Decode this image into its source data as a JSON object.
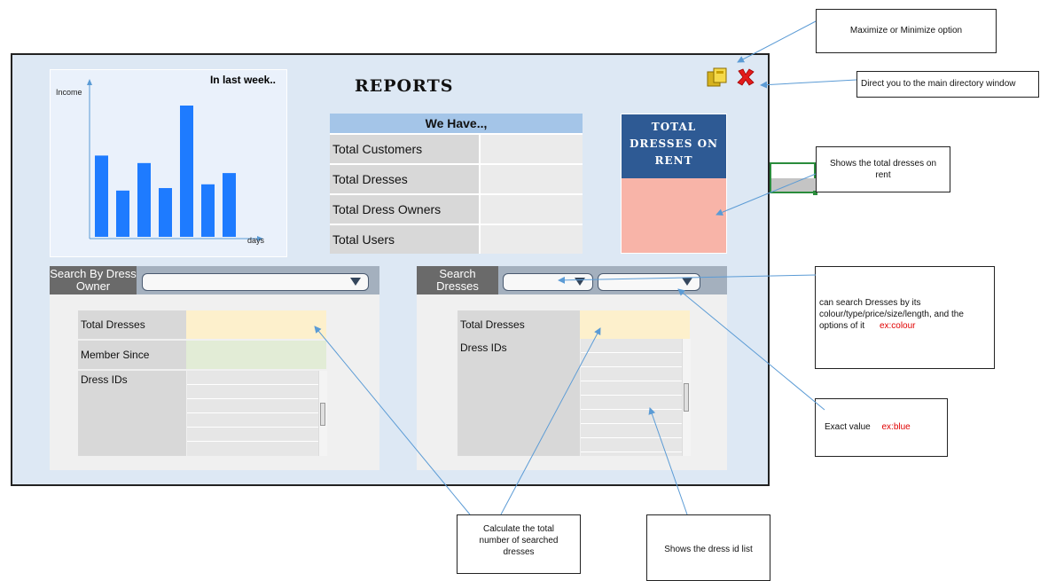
{
  "reports": {
    "title": "REPORTS",
    "chart": {
      "title": "In last week..",
      "ylabel": "Income",
      "xlabel": "days"
    },
    "we_have": {
      "header": "We Have..,",
      "rows": [
        "Total Customers",
        "Total Dresses",
        "Total Dress Owners",
        "Total Users"
      ]
    },
    "rent_box": {
      "title": "TOTAL DRESSES ON RENT"
    },
    "owner_search": {
      "tag": "Search By Dress Owner",
      "total_label": "Total Dresses",
      "member_label": "Member Since",
      "ids_label": "Dress IDs"
    },
    "dress_search": {
      "tag": "Search Dresses",
      "total_label": "Total Dresses",
      "ids_label": "Dress IDs"
    }
  },
  "colors": {
    "form_bg": "#dde8f4",
    "bar_color": "#1e7bff",
    "rent_header": "#2e5a94",
    "rent_body": "#f8b4a8",
    "total_field": "#fdf0cc",
    "member_field": "#e2ecd6",
    "annotation_red": "#e00000"
  },
  "icons": {
    "maximize": "maximize-minimize-icon",
    "close": "close-x-icon"
  },
  "annotations": {
    "maximize": "Maximize or Minimize option",
    "directory": "Direct you to the main directory window",
    "total_rent": "Shows the total dresses on rent",
    "search_help": "can search Dresses by its colour/type/price/size/length, and the options of it",
    "search_help_example": "ex:colour",
    "exact_value": "Exact value",
    "exact_value_example": "ex:blue",
    "calculate": "Calculate the total number of searched dresses",
    "id_list": "Shows the dress id list"
  },
  "chart_data": {
    "type": "bar",
    "title": "In last week..",
    "xlabel": "days",
    "ylabel": "Income",
    "values": [
      6.5,
      3.7,
      5.9,
      3.9,
      10.5,
      4.2,
      5.1
    ]
  }
}
